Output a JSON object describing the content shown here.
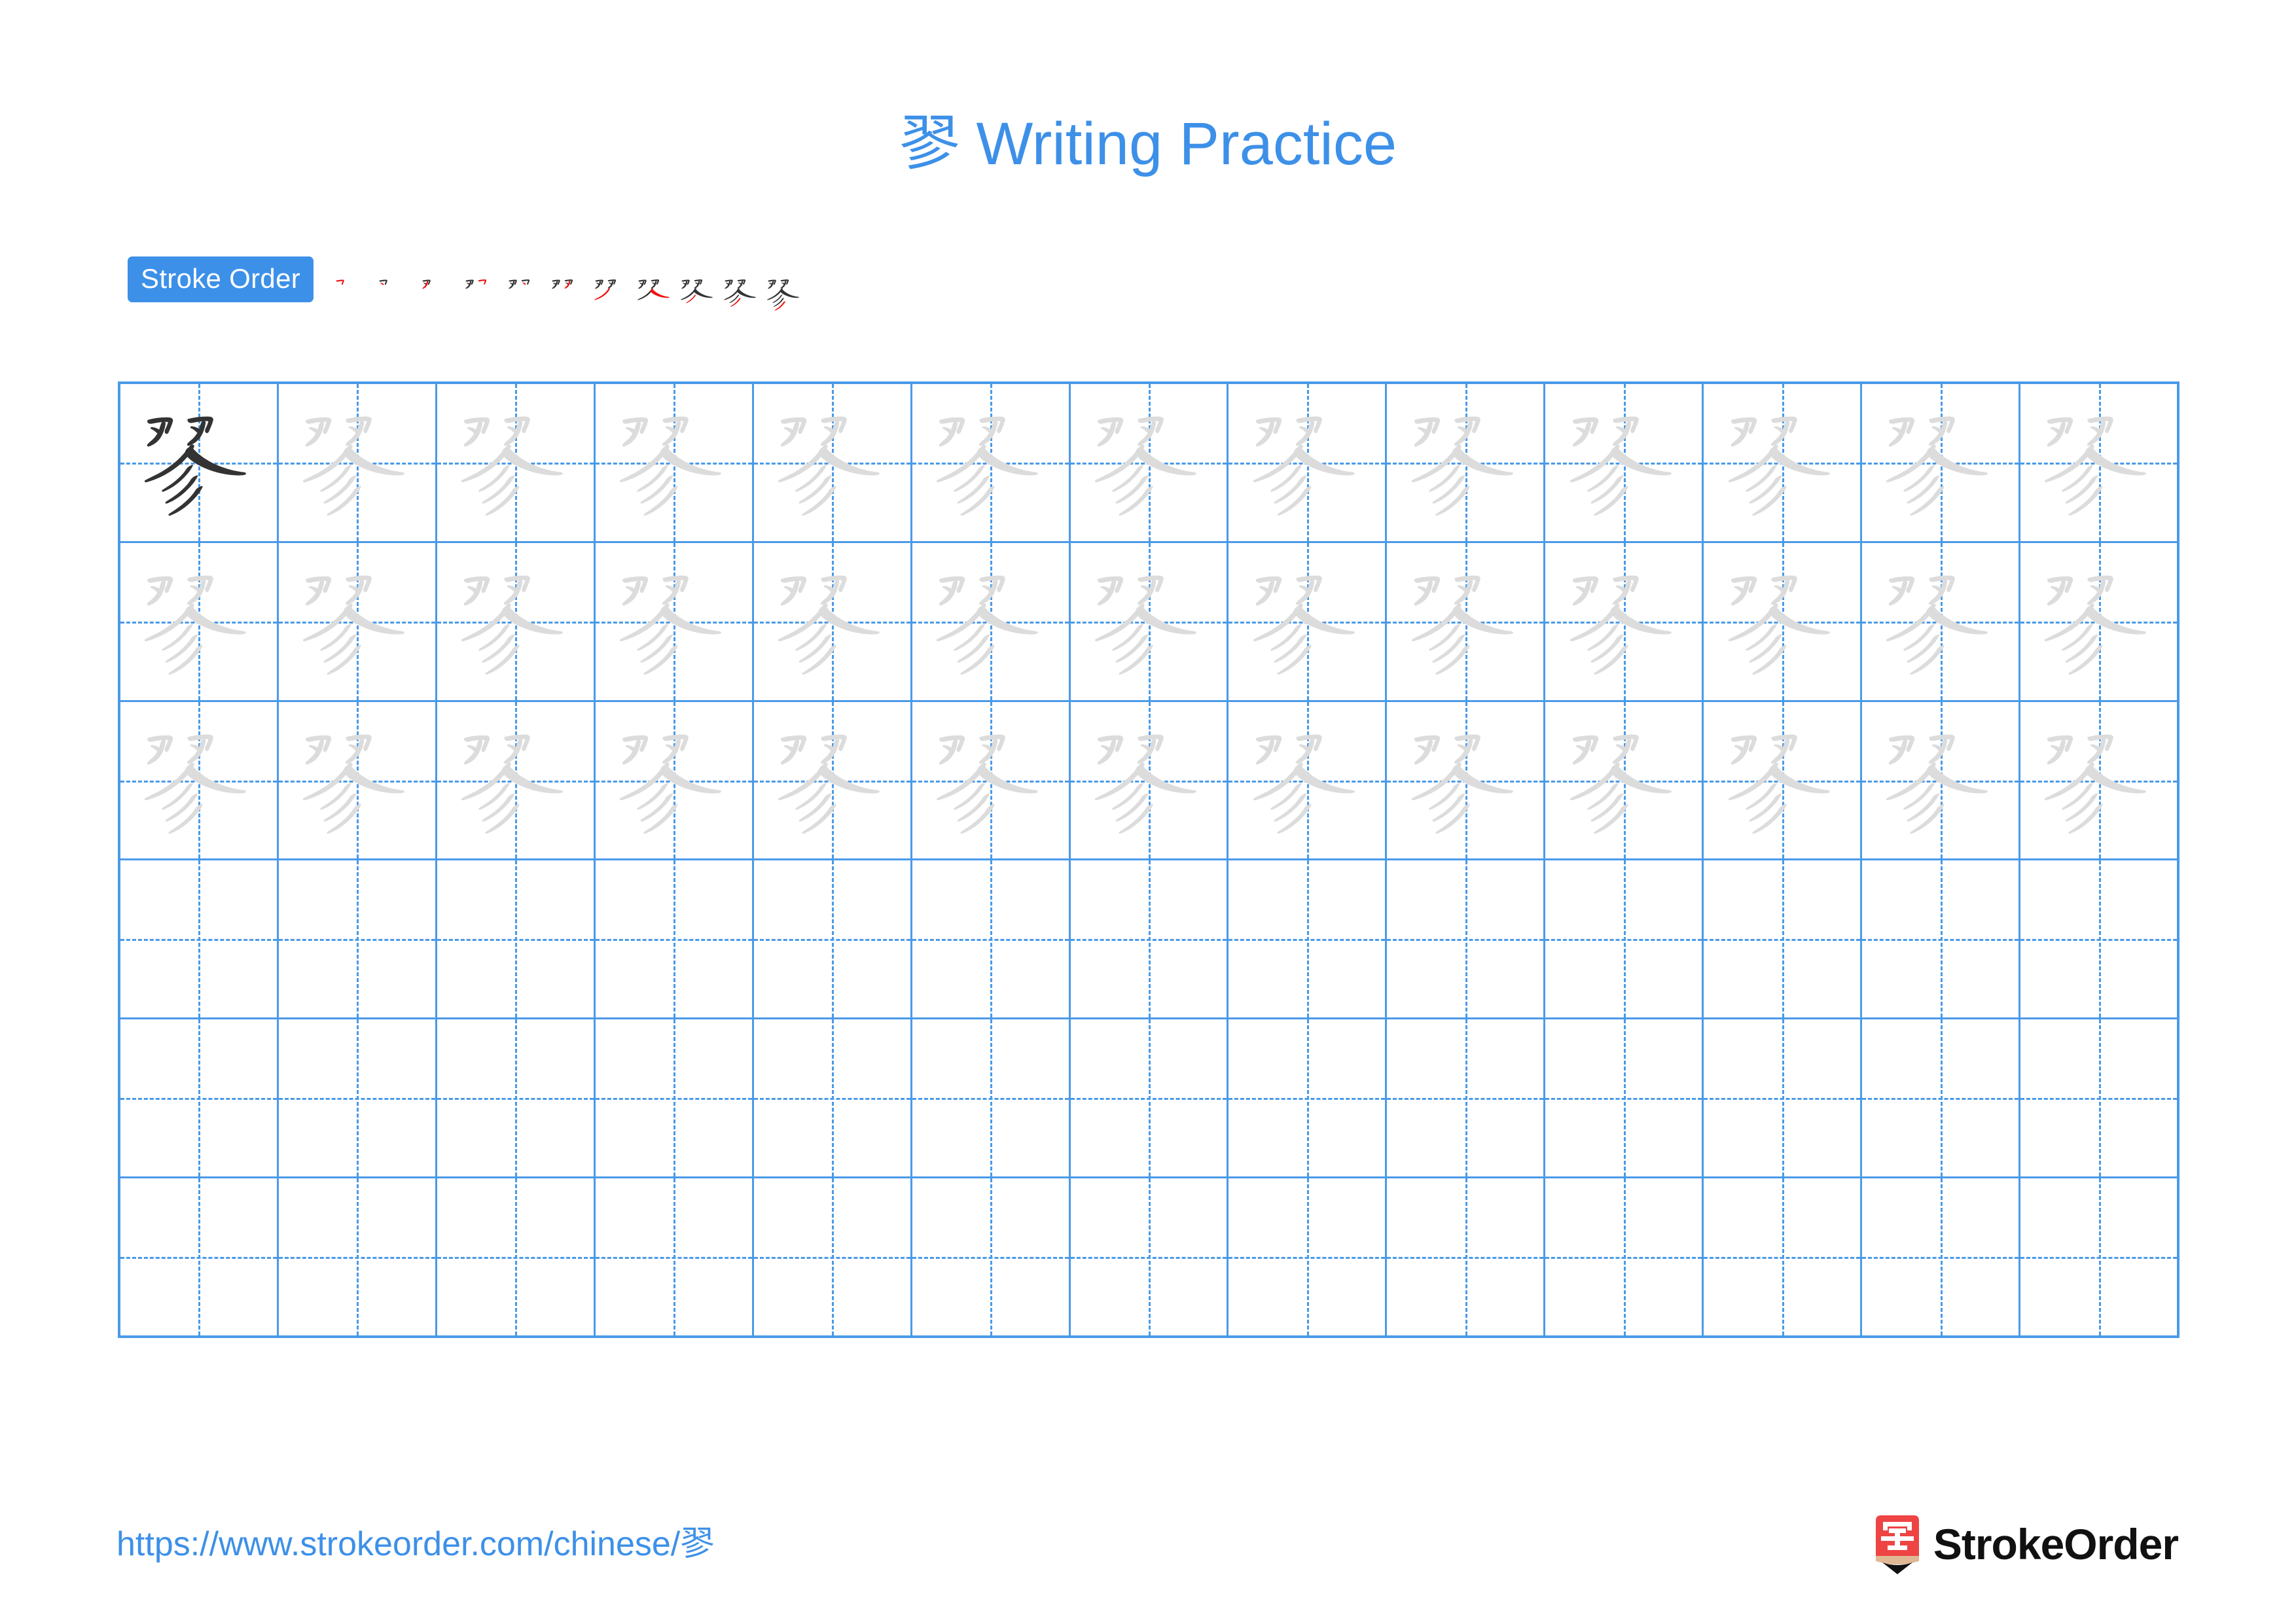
{
  "document": {
    "character": "翏",
    "title_suffix": " Writing Practice",
    "title_full": "翏 Writing Practice"
  },
  "stroke_order": {
    "badge_label": "Stroke Order",
    "total_strokes": 11,
    "current_stroke_color": "#ee1111",
    "completed_stroke_color": "#333333",
    "steps": [
      {
        "index": 1,
        "strokes_shown": 1,
        "new_stroke": 1
      },
      {
        "index": 2,
        "strokes_shown": 2,
        "new_stroke": 2
      },
      {
        "index": 3,
        "strokes_shown": 3,
        "new_stroke": 3
      },
      {
        "index": 4,
        "strokes_shown": 4,
        "new_stroke": 4
      },
      {
        "index": 5,
        "strokes_shown": 5,
        "new_stroke": 5
      },
      {
        "index": 6,
        "strokes_shown": 6,
        "new_stroke": 6
      },
      {
        "index": 7,
        "strokes_shown": 7,
        "new_stroke": 7
      },
      {
        "index": 8,
        "strokes_shown": 8,
        "new_stroke": 8
      },
      {
        "index": 9,
        "strokes_shown": 9,
        "new_stroke": 9
      },
      {
        "index": 10,
        "strokes_shown": 10,
        "new_stroke": 10
      },
      {
        "index": 11,
        "strokes_shown": 11,
        "new_stroke": 11
      }
    ]
  },
  "practice_grid": {
    "columns": 13,
    "rows": 6,
    "grid_line_color": "#4a9ae8",
    "traced_character_color": "#dcdcdc",
    "model_character_color": "#333333",
    "row_fill": [
      {
        "row": 1,
        "cells": [
          "dark",
          "light",
          "light",
          "light",
          "light",
          "light",
          "light",
          "light",
          "light",
          "light",
          "light",
          "light",
          "light"
        ]
      },
      {
        "row": 2,
        "cells": [
          "light",
          "light",
          "light",
          "light",
          "light",
          "light",
          "light",
          "light",
          "light",
          "light",
          "light",
          "light",
          "light"
        ]
      },
      {
        "row": 3,
        "cells": [
          "light",
          "light",
          "light",
          "light",
          "light",
          "light",
          "light",
          "light",
          "light",
          "light",
          "light",
          "light",
          "light"
        ]
      },
      {
        "row": 4,
        "cells": [
          "empty",
          "empty",
          "empty",
          "empty",
          "empty",
          "empty",
          "empty",
          "empty",
          "empty",
          "empty",
          "empty",
          "empty",
          "empty"
        ]
      },
      {
        "row": 5,
        "cells": [
          "empty",
          "empty",
          "empty",
          "empty",
          "empty",
          "empty",
          "empty",
          "empty",
          "empty",
          "empty",
          "empty",
          "empty",
          "empty"
        ]
      },
      {
        "row": 6,
        "cells": [
          "empty",
          "empty",
          "empty",
          "empty",
          "empty",
          "empty",
          "empty",
          "empty",
          "empty",
          "empty",
          "empty",
          "empty",
          "empty"
        ]
      }
    ]
  },
  "footer": {
    "url": "https://www.strokeorder.com/chinese/翏",
    "brand_name": "StrokeOrder",
    "brand_mark_character": "字",
    "brand_mark_color": "#ef4444",
    "brand_mark_tip_color": "#e0b894"
  },
  "colors": {
    "accent_blue": "#3d90e8",
    "grid_blue": "#4a9ae8",
    "ink": "#333333",
    "ghost": "#dcdcdc",
    "highlight_red": "#ee1111",
    "background": "#ffffff"
  }
}
